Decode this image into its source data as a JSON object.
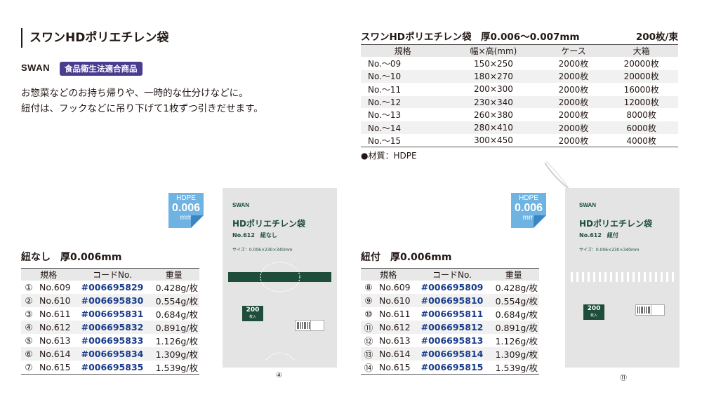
{
  "header": {
    "title": "スワンHDポリエチレン袋",
    "brand": "SWAN",
    "badge": "食品衛生法適合商品",
    "desc_line1": "お惣菜などのお持ち帰りや、一時的な仕分けなどに。",
    "desc_line2": "紐付は、フックなどに吊り下げて1枚ずつ引きだせます。"
  },
  "spec": {
    "title": "スワンHDポリエチレン袋　厚0.006〜0.007mm",
    "unit": "200枚/束",
    "columns": [
      "規格",
      "幅×高(mm)",
      "ケース",
      "大箱"
    ],
    "rows": [
      [
        "No.〜09",
        "150×250",
        "2000枚",
        "20000枚"
      ],
      [
        "No.〜10",
        "180×270",
        "2000枚",
        "20000枚"
      ],
      [
        "No.〜11",
        "200×300",
        "2000枚",
        "16000枚"
      ],
      [
        "No.〜12",
        "230×340",
        "2000枚",
        "12000枚"
      ],
      [
        "No.〜13",
        "260×380",
        "2000枚",
        "8000枚"
      ],
      [
        "No.〜14",
        "280×410",
        "2000枚",
        "6000枚"
      ],
      [
        "No.〜15",
        "300×450",
        "2000枚",
        "4000枚"
      ]
    ],
    "material": "●材質：HDPE"
  },
  "sections": [
    {
      "title": "紐なし　厚0.006mm",
      "columns": [
        "規格",
        "コードNo.",
        "重量"
      ],
      "rows": [
        [
          "①",
          "No.609",
          "#006695829",
          "0.428g/枚"
        ],
        [
          "②",
          "No.610",
          "#006695830",
          "0.554g/枚"
        ],
        [
          "③",
          "No.611",
          "#006695831",
          "0.684g/枚"
        ],
        [
          "④",
          "No.612",
          "#006695832",
          "0.891g/枚"
        ],
        [
          "⑤",
          "No.613",
          "#006695833",
          "1.126g/枚"
        ],
        [
          "⑥",
          "No.614",
          "#006695834",
          "1.309g/枚"
        ],
        [
          "⑦",
          "No.615",
          "#006695835",
          "1.539g/枚"
        ]
      ]
    },
    {
      "title": "紐付　厚0.006mm",
      "columns": [
        "規格",
        "コードNo.",
        "重量"
      ],
      "rows": [
        [
          "⑧",
          "No.609",
          "#006695809",
          "0.428g/枚"
        ],
        [
          "⑨",
          "No.610",
          "#006695810",
          "0.554g/枚"
        ],
        [
          "⑩",
          "No.611",
          "#006695811",
          "0.684g/枚"
        ],
        [
          "⑪",
          "No.612",
          "#006695812",
          "0.891g/枚"
        ],
        [
          "⑫",
          "No.613",
          "#006695813",
          "1.126g/枚"
        ],
        [
          "⑬",
          "No.614",
          "#006695814",
          "1.309g/枚"
        ],
        [
          "⑭",
          "No.615",
          "#006695815",
          "1.539g/枚"
        ]
      ]
    }
  ],
  "hdpe_badge": {
    "line1": "HDPE",
    "line2": "0.006",
    "line3": "mm"
  },
  "bags": [
    {
      "brand": "SWAN",
      "title": "HDポリエチレン袋",
      "no": "No.612　紐なし",
      "size": "サイズ：0.006×230×340mm",
      "count": "200",
      "count_unit": "枚入",
      "caption": "④"
    },
    {
      "brand": "SWAN",
      "title": "HDポリエチレン袋",
      "no": "No.612　紐付",
      "size": "サイズ：0.006×230×340mm",
      "count": "200",
      "count_unit": "枚入",
      "caption": "⑪"
    }
  ],
  "colors": {
    "badge_bg": "#4a3d8f",
    "code_blue": "#1a3c8a",
    "bag_green": "#1e4d3c",
    "hdpe_blue": "#6fb3e3"
  }
}
